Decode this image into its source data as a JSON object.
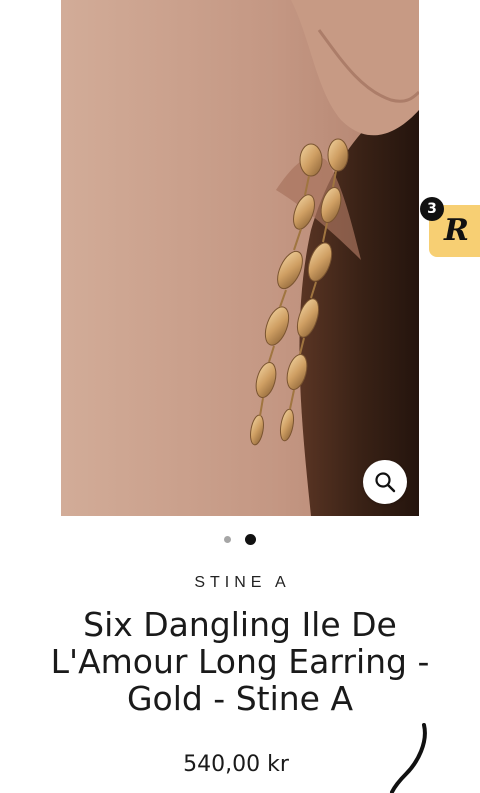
{
  "gallery": {
    "image_alt": "Six Dangling Ile De L'Amour Long Earring - Gold - Stine A",
    "zoom_icon": "search-icon",
    "slides": [
      {
        "active": false
      },
      {
        "active": true
      }
    ]
  },
  "rewards": {
    "letter": "R",
    "count": "3",
    "color": "#f7cf73"
  },
  "product": {
    "vendor": "STINE A",
    "title": "Six Dangling Ile De L'Amour Long Earring - Gold - Stine A",
    "price": "540,00 kr"
  }
}
